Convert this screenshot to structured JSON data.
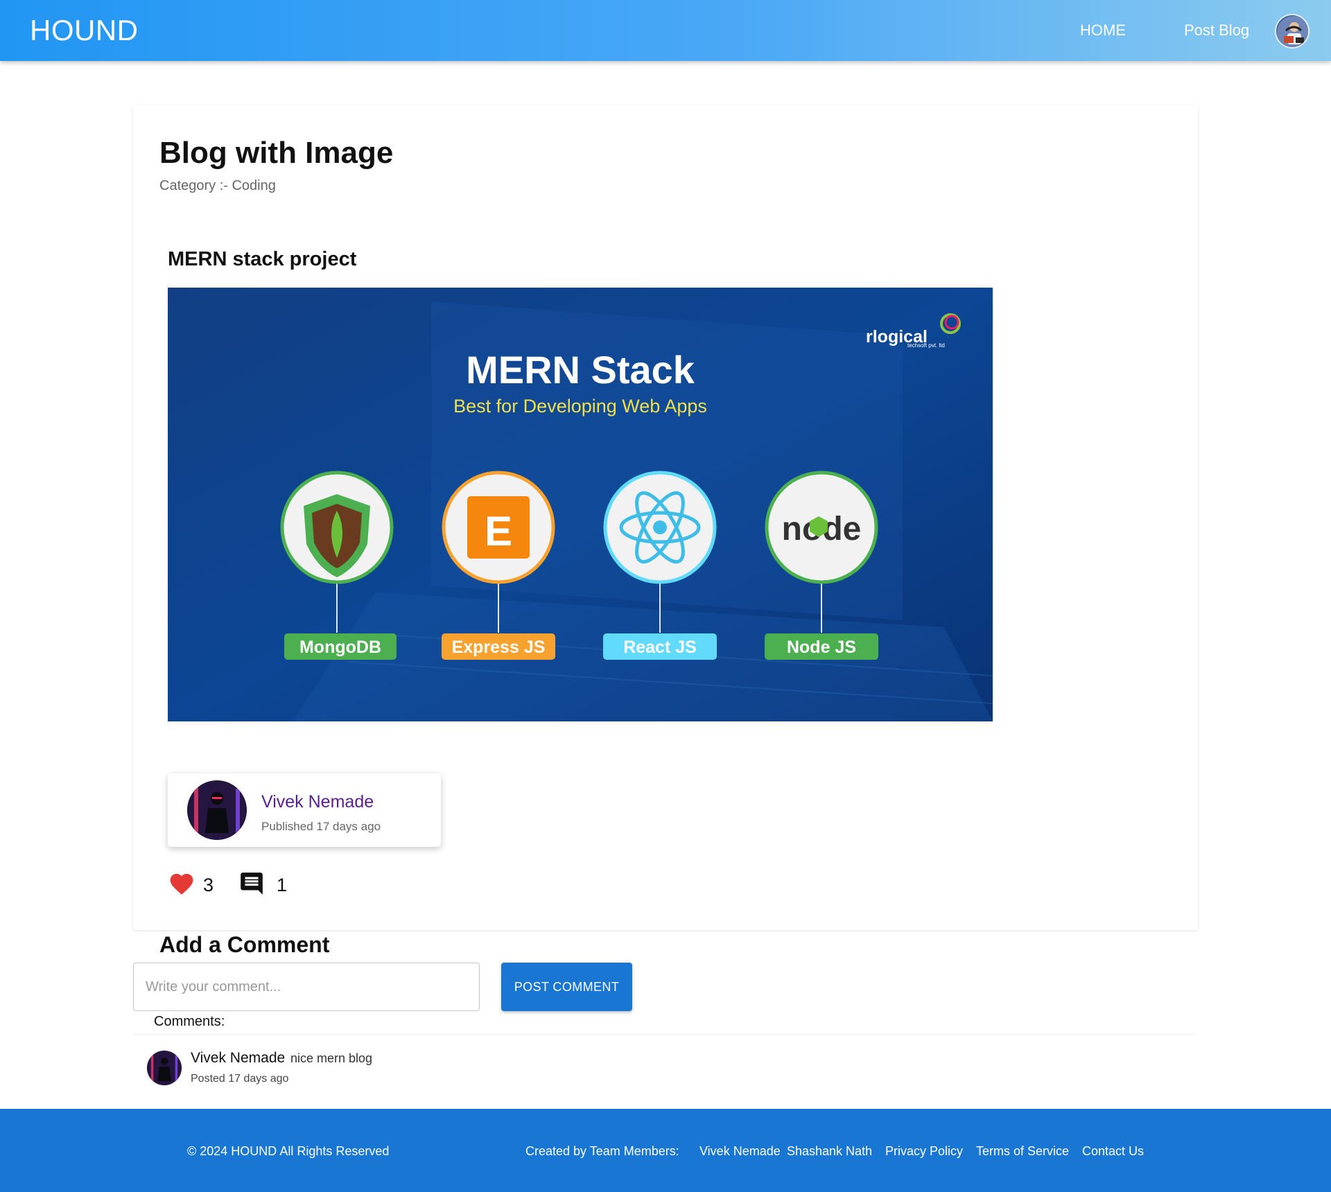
{
  "navbar": {
    "brand": "HOUND",
    "home_label": "HOME",
    "post_blog_label": "Post Blog",
    "avatar_icon": "user-avatar"
  },
  "post": {
    "page_title": "Blog with Image",
    "category_label": "Category :- Coding",
    "heading": "MERN stack project",
    "banner": {
      "logo_text": "rlogical",
      "logo_sub": "techsoft pvt. ltd",
      "title": "MERN Stack",
      "subtitle": "Best for Developing Web Apps",
      "items": [
        {
          "label": "MongoDB",
          "color": "#4caf50"
        },
        {
          "label": "Express JS",
          "color": "#f7a12e"
        },
        {
          "label": "React JS",
          "color": "#61dafb"
        },
        {
          "label": "Node JS",
          "color": "#4caf50"
        }
      ]
    },
    "author": {
      "name": "Vivek Nemade",
      "published": "Published 17 days ago"
    },
    "likes": "3",
    "comments_count": "1"
  },
  "comment_form": {
    "title": "Add a Comment",
    "placeholder": "Write your comment...",
    "value": "",
    "button_label": "POST COMMENT"
  },
  "comments": {
    "label": "Comments:",
    "items": [
      {
        "author": "Vivek Nemade",
        "text": "nice mern blog",
        "meta": "Posted 17 days ago"
      }
    ]
  },
  "footer": {
    "copyright": "© 2024 HOUND All Rights Reserved",
    "created_by": "Created by Team Members:",
    "member1": "Vivek Nemade",
    "member2": "Shashank Nath",
    "privacy": "Privacy Policy",
    "terms": "Terms of Service",
    "contact": "Contact Us"
  },
  "colors": {
    "nav_gradient_start": "#2196f3",
    "nav_gradient_end": "#8ccbef",
    "primary": "#1976d2",
    "author_name": "#5b1f8f",
    "like": "#e53935"
  }
}
